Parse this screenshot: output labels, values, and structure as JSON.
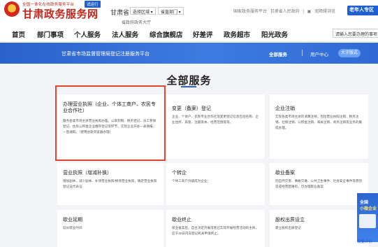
{
  "header": {
    "logo_subtitle": "全国一体化在线政务服务平台",
    "logo_title": "甘肃政务服务网",
    "badge": "试运行",
    "province": "甘肃省",
    "region_select": "选择区域 ▾",
    "dept_select": "省直部门 ▾",
    "hall_link": "省政府政务大厅",
    "top_links": [
      "国家政务服务平台",
      "甘肃省人民政府",
      "|",
      "无障碍浏览"
    ],
    "elder_button": "老年人专区"
  },
  "nav": {
    "items": [
      "首页",
      "部门事项",
      "个人服务",
      "法人服务",
      "综合旗舰店",
      "好差评",
      "政务超市",
      "阳光政务"
    ],
    "search_placeholder": "请输入您要办理的事项"
  },
  "banner": {
    "title": "甘肃省市场监督管理局登记注册服务平台",
    "links": [
      "全部服务",
      "用户中心"
    ],
    "big_font_button": "大字版式"
  },
  "section": {
    "title": "全部服务"
  },
  "cards": [
    {
      "title": "办理营业执照（企业、个体工商户、农民专业合作社）",
      "desc": [
        "服务各类市场主体营业执照办理。公章刻制、税务登记、员工参保登记、住房公积金企业缴存登记等环节，实现企业开办一表填报、一窗通取。（使用谷歌浏览器办理）"
      ]
    },
    {
      "title": "变更（备案）登记",
      "desc": [
        "企业、个体户、农民专业合作社等变更登记信息包括名称、企业住所、高管、注册资本、经营范围等等。"
      ]
    },
    {
      "title": "企业注销",
      "desc": [
        "实现各类市场主体的清算注销，包括营业执照注销、税务注销、社保注销、公积金注销、海关注销、商务注销等业务的集成办理。"
      ]
    },
    {
      "title": "营业执照（增减补换）",
      "desc": [
        "增加副本、减少副本、补领营业执照/换领营业执照，确定营业执照登记证代表证"
      ]
    },
    {
      "title": "个转企",
      "desc": [
        "个体工商户升级成为企业；"
      ]
    },
    {
      "title": "歇业备案",
      "desc": [
        "因自然灾害、事故灾难、公共卫生事件、社会安全事件等原因造成经营困难的，可办理歇业备案"
      ]
    },
    {
      "title": "歇业延期",
      "desc": [
        "延长歇业时间"
      ]
    },
    {
      "title": "歇业终止",
      "desc": [
        "歇业备案后，自主决定开展或者已实际开展经营活动的主体，应于30日内向登记机关申请终止。"
      ]
    },
    {
      "title": "股权出质设立",
      "desc": [
        "建立股权出质登记"
      ]
    }
  ],
  "float_panel": {
    "line1": "全国",
    "line2": "小微企业",
    "rating": "我要评价"
  },
  "colors": {
    "brand_red": "#c4271b",
    "primary_blue": "#2a62c9",
    "highlight_red": "#e2472d",
    "page_bg": "#f2f4f7"
  }
}
